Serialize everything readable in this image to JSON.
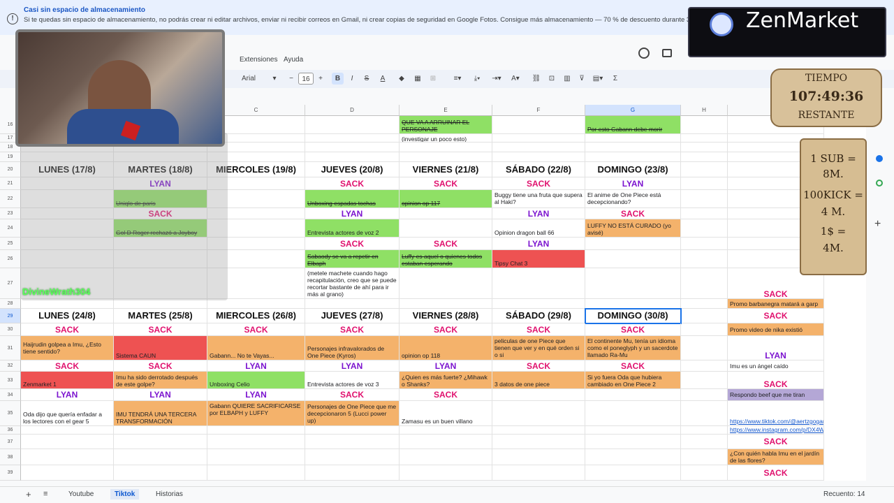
{
  "banner": {
    "title": "Casi sin espacio de almacenamiento",
    "text": "Si te quedas sin espacio de almacenamiento, no podrás crear ni editar archivos, enviar ni recibir correos en Gmail, ni crear copias de seguridad en Google Fotos. Consigue más almacenamiento — 70 % de descuento durante 3"
  },
  "menu": [
    "Extensiones",
    "Ayuda"
  ],
  "toolbar": {
    "font": "Arial",
    "font_size": "16",
    "bold": "B",
    "italic": "I",
    "strike": "S",
    "color": "A",
    "minus": "−",
    "plus": "+",
    "sigma": "Σ"
  },
  "columns": [
    "C",
    "D",
    "E",
    "F",
    "G",
    "H"
  ],
  "rows": [
    "16",
    "17",
    "18",
    "19",
    "20",
    "21",
    "22",
    "23",
    "24",
    "25",
    "26",
    "27",
    "28",
    "29",
    "30",
    "31",
    "32",
    "33",
    "34",
    "35",
    "36",
    "37",
    "38",
    "39"
  ],
  "week1": {
    "headers": [
      "LUNES (17/8)",
      "MARTES (18/8)",
      "MIERCOLES (19/8)",
      "JUEVES (20/8)",
      "VIERNES (21/8)",
      "SÁBADO (22/8)",
      "DOMINGO (23/8)"
    ],
    "r16_e": "QUE VA A ARRUINAR EL PERSONAJE",
    "r16_g": "Por esto Gabann debe morir",
    "r17_e": "(investigar un poco esto)",
    "r21": [
      "LYAN",
      "SACK",
      "SACK",
      "SACK",
      "LYAN"
    ],
    "r22": [
      "Uniqlo de paris",
      "Unboxing espadas tochas",
      "opinion op 117",
      "Buggy tiene una fruta que supera al Haki?",
      "El anime de One Piece está decepcionando?"
    ],
    "r23": [
      "SACK",
      "LYAN",
      "LYAN",
      "SACK"
    ],
    "r24": [
      "Gol D Roger rechazó a Joyboy",
      "Entrevista actores de voz 2",
      "Opinion dragon ball 66",
      "LUFFY NO ESTÁ CURADO (yo avisé)"
    ],
    "r25": [
      "SACK",
      "SACK",
      "LYAN"
    ],
    "r26": [
      "Sabaody se va a repetir en Elbaph",
      "Luffy es aquel o quienes todos estaban esperando",
      "Tipsy Chat 3"
    ],
    "r27_d": "(metele machete cuando hago recapitulación, creo que se puede recortar bastante de ahí para ir más al grano)"
  },
  "week2": {
    "headers": [
      "LUNES (24/8)",
      "MARTES (25/8)",
      "MIERCOLES (26/8)",
      "JUEVES (27/8)",
      "VIERNES (28/8)",
      "SÁBADO (29/8)",
      "DOMINGO (30/8)"
    ],
    "r30": [
      "SACK",
      "SACK",
      "SACK",
      "SACK",
      "SACK",
      "SACK",
      "SACK"
    ],
    "r31": [
      "Haijrudin golpea a Imu, ¿Esto tiene sentido?",
      "Sistema CAUN",
      "Gabann... No te Vayas...",
      "Personajes infravalorados de One Piece (Kyros)",
      "opinion op 118",
      "peliculas de one Piece que tienen que ver y en qué orden si o si",
      "El continente Mu, tenía un idioma como el poneglyph y un sacerdote llamado Ra-Mu"
    ],
    "r32": [
      "SACK",
      "SACK",
      "LYAN",
      "LYAN",
      "LYAN",
      "SACK",
      "SACK"
    ],
    "r33": [
      "Zenmarket 1",
      "Imu ha sido derrotado después de este golpe?",
      "Unboxing Celio",
      "Entrevista actores de voz 3",
      "¿Quien es más fuerte? ¿Mihawk o Shanks?",
      "3 datos de one piece",
      "Si yo fuera Oda que hubiera cambiado en One Piece 2"
    ],
    "r34": [
      "LYAN",
      "LYAN",
      "LYAN",
      "SACK",
      "SACK"
    ],
    "r35": [
      "Oda dijo que quería enfadar a los lectores con el gear 5",
      "IMU TENDRÁ UNA TERCERA TRANSFORMACIÓN",
      "Gabann QUIERE SACRIFICARSE por ELBAPH y LUFFY",
      "Personajes de One Piece que me decepcionaron 5 (Lucci power up)",
      "Zamasu es un buen villano"
    ]
  },
  "right_col": {
    "r27": "SACK",
    "r28": "Promo barbanegra matará a garp",
    "r29": "SACK",
    "r30": "Promo video de nika existió",
    "r31": "LYAN",
    "r32": "Imu es un ángel caído",
    "r33": "SACK",
    "r34": "Respondo beef que me tiran",
    "r35": "https://www.tiktok.com/@aertzgogames/video/76",
    "r36": "https://www.instagram.com/p/DX4WBkcsuAF/",
    "r37": "SACK",
    "r38": "¿Con quién habla Imu en el jardín de las flores?",
    "r39": "SACK"
  },
  "sheets": [
    "Youtube",
    "Tiktok",
    "Historias"
  ],
  "status": "Recuento: 14",
  "overlay": {
    "username": "DivineWrath304",
    "sponsor": "ZenMarket",
    "timer_title": "TIEMPO",
    "timer_value": "107:49:36",
    "timer_sub": "RESTANTE",
    "scroll_lines": [
      "1 SUB =",
      "8M.",
      "100KICK =",
      "4 M.",
      "1$ =",
      "4M."
    ]
  },
  "colors": {
    "sack": "#e0116e",
    "lyan": "#7c14cf",
    "green": "#8fe065",
    "orange": "#f4b26b",
    "red": "#ee5252",
    "purple": "#b4a7d6"
  }
}
